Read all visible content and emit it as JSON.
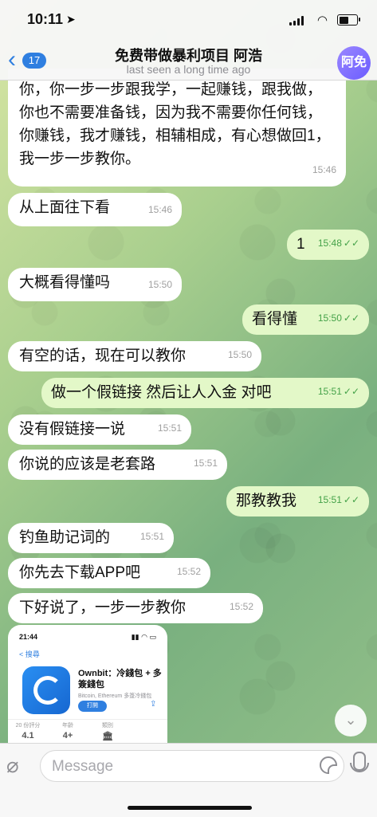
{
  "status_bar": {
    "time": "10:11",
    "location_arrow": "location-arrow-icon"
  },
  "header": {
    "back_count": "17",
    "title": "免费带做暴利项目 阿浩",
    "subtitle": "last seen a long time ago",
    "avatar_text": "阿免"
  },
  "messages": [
    {
      "dir": "in",
      "text": "你，你一步一步跟我学，一起赚钱，跟我做，你也不需要准备钱，因为我不需要你任何钱，你赚钱，我才赚钱，相辅相成，有心想做回1，我一步一步教你。",
      "time": "15:46"
    },
    {
      "dir": "in",
      "text": "从上面往下看",
      "time": "15:46"
    },
    {
      "dir": "out",
      "text": "1",
      "time": "15:48"
    },
    {
      "dir": "in",
      "text": "大概看得懂吗",
      "time": "15:50"
    },
    {
      "dir": "out",
      "text": "看得懂",
      "time": "15:50"
    },
    {
      "dir": "in",
      "text": "有空的话，现在可以教你",
      "time": "15:50"
    },
    {
      "dir": "out",
      "text": "做一个假链接 然后让人入金 对吧",
      "time": "15:51"
    },
    {
      "dir": "in",
      "text": "没有假链接一说",
      "time": "15:51"
    },
    {
      "dir": "in",
      "text": "你说的应该是老套路",
      "time": "15:51"
    },
    {
      "dir": "out",
      "text": "那教教我",
      "time": "15:51"
    },
    {
      "dir": "in",
      "text": "钓鱼助记词的",
      "time": "15:51"
    },
    {
      "dir": "in",
      "text": "你先去下载APP吧",
      "time": "15:52"
    },
    {
      "dir": "in",
      "text": "下好说了，一步一步教你",
      "time": "15:52"
    }
  ],
  "image_message": {
    "time": "21:44",
    "search": "< 搜尋",
    "app_name": "Ownbit：冷錢包 + 多簽錢包",
    "app_sub": "Bitcoin, Ethereum 多簽冷錢包",
    "get_label": "打開",
    "stats": [
      {
        "label": "20 份評分",
        "value": "4.1"
      },
      {
        "label": "年齡",
        "value": "4+"
      },
      {
        "label": "類別",
        "value": "🏛"
      }
    ]
  },
  "input": {
    "placeholder": "Message"
  },
  "check_mark": "✓✓"
}
